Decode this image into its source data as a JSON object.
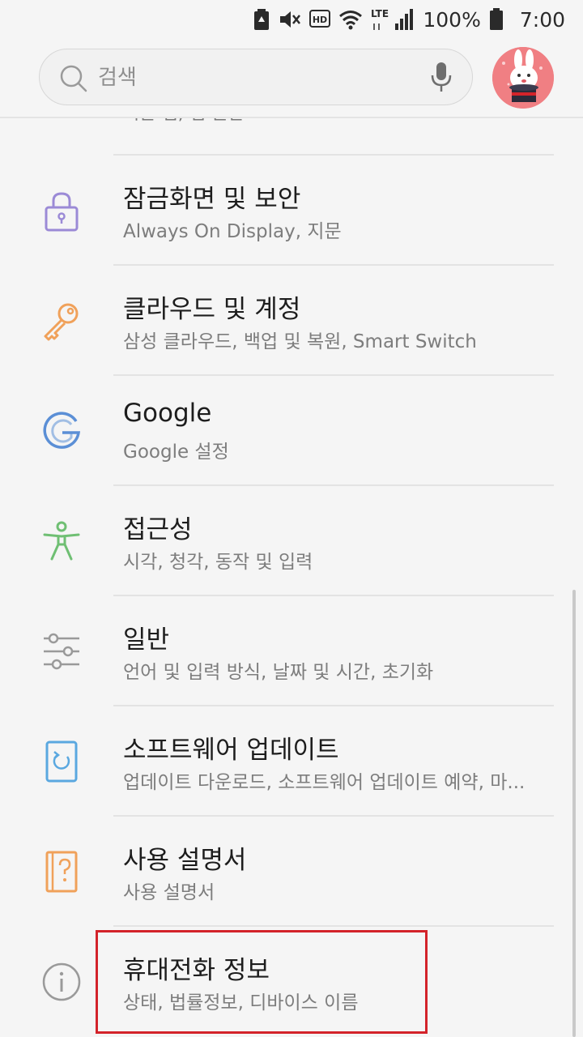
{
  "status_bar": {
    "battery_percent": "100%",
    "time": "7:00",
    "network": "LTE",
    "hd": "HD"
  },
  "search": {
    "placeholder": "검색"
  },
  "previous_item_subtitle": "기본 앱, 앱 권한",
  "items": [
    {
      "icon": "lock-icon",
      "title": "잠금화면 및 보안",
      "subtitle": "Always On Display, 지문",
      "color": "#9b8ad6"
    },
    {
      "icon": "key-icon",
      "title": "클라우드 및 계정",
      "subtitle": "삼성 클라우드, 백업 및 복원, Smart Switch",
      "color": "#f0a15a"
    },
    {
      "icon": "google-icon",
      "title": "Google",
      "subtitle": "Google 설정",
      "color": "#5b8fd6"
    },
    {
      "icon": "accessibility-icon",
      "title": "접근성",
      "subtitle": "시각, 청각, 동작 및 입력",
      "color": "#6fbf73"
    },
    {
      "icon": "sliders-icon",
      "title": "일반",
      "subtitle": "언어 및 입력 방식, 날짜 및 시간, 초기화",
      "color": "#9a9a9a"
    },
    {
      "icon": "software-update-icon",
      "title": "소프트웨어 업데이트",
      "subtitle": "업데이트 다운로드, 소프트웨어 업데이트 예약, 마...",
      "color": "#5aa8e0"
    },
    {
      "icon": "user-manual-icon",
      "title": "사용 설명서",
      "subtitle": "사용 설명서",
      "color": "#f0a15a"
    },
    {
      "icon": "info-icon",
      "title": "휴대전화 정보",
      "subtitle": "상태, 법률정보, 디바이스 이름",
      "color": "#9a9a9a"
    }
  ],
  "highlight_color": "#d3232a"
}
